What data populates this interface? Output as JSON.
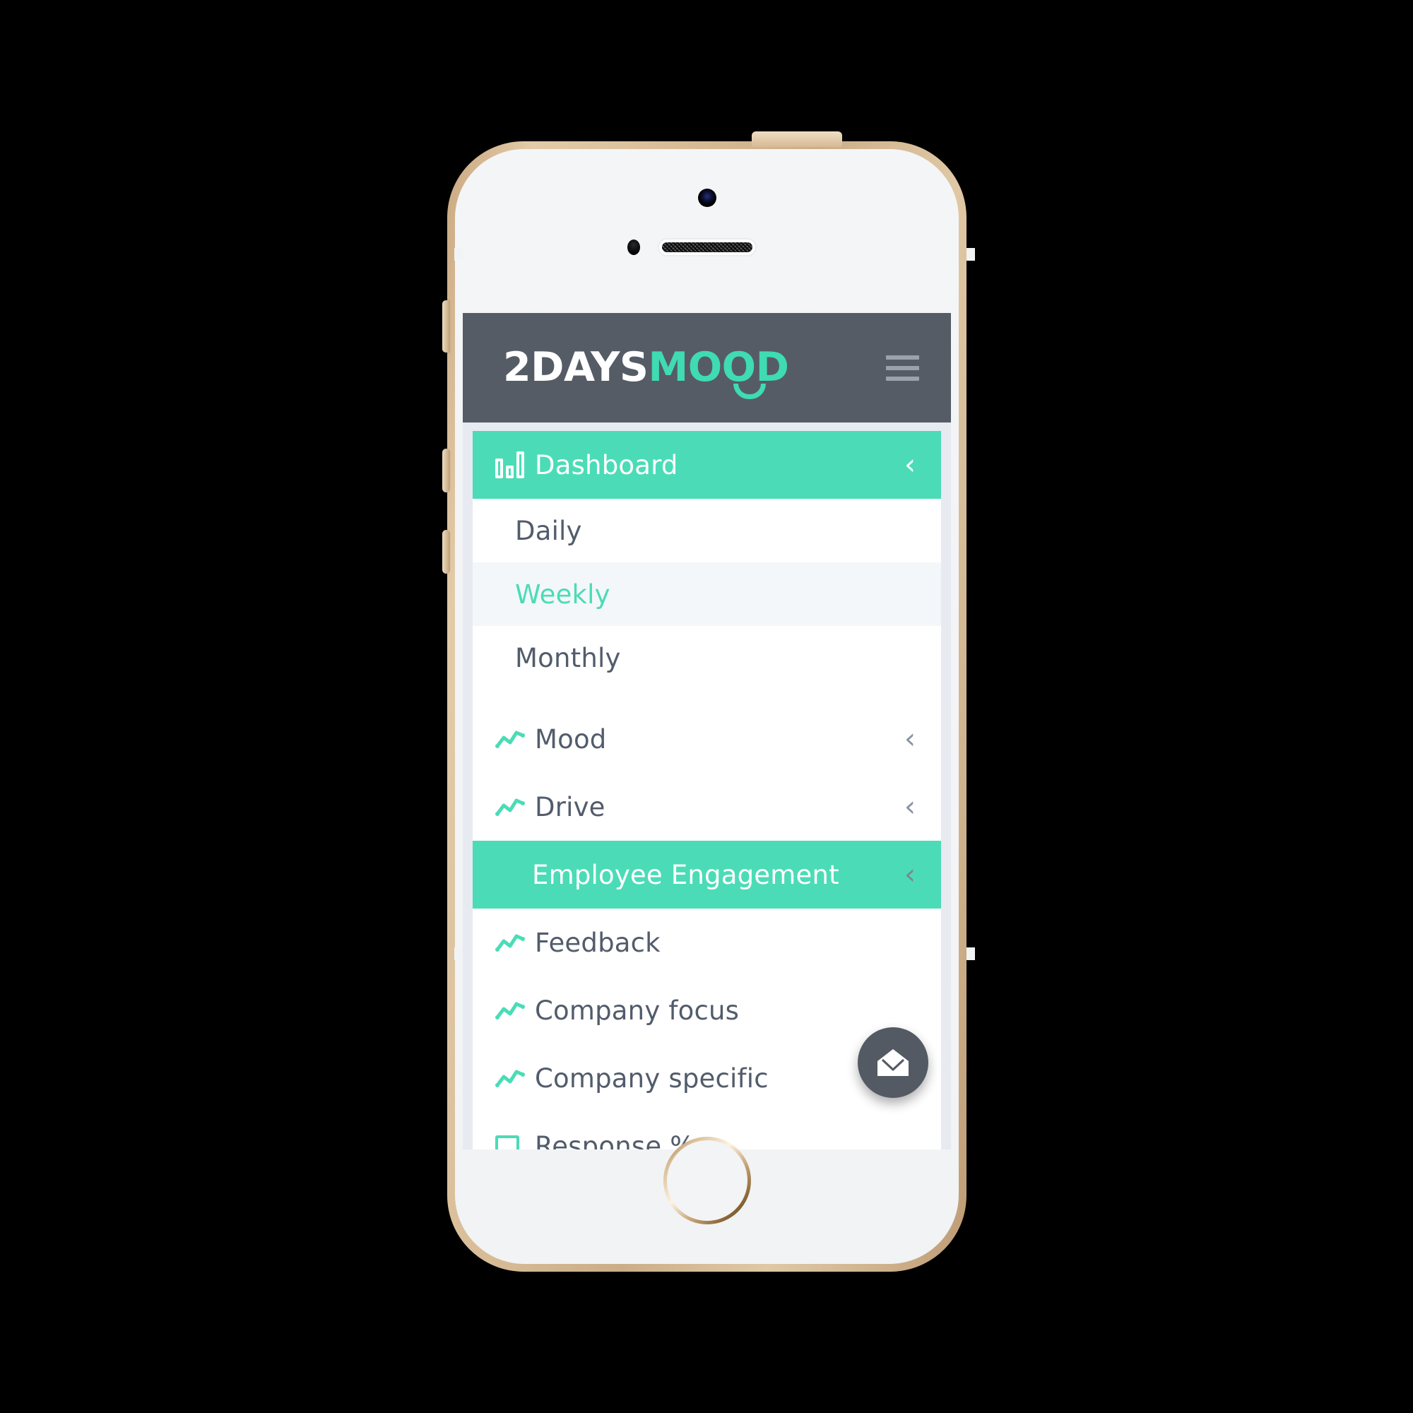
{
  "device": {
    "name": "iphone-gold",
    "bezel_color": "#D5BB95",
    "face_color": "#F3F4F6"
  },
  "screen": {
    "background": "#E7EAF0",
    "card_background": "#FFFFFF"
  },
  "appbar": {
    "background": "#565C66",
    "logo": {
      "part_one": "2DAYS",
      "part_two": "MOOD",
      "part_one_color": "#FFFFFF",
      "part_two_color": "#3FDBB1",
      "smile_icon": "smile-arc-icon"
    },
    "menu_button": {
      "icon": "hamburger-icon",
      "line_color": "#9AA2AE"
    }
  },
  "accent": {
    "teal": "#4BDCB7",
    "text_dark": "#525C6B",
    "highlight_row": "#F4F7FA"
  },
  "sidebar": {
    "items": [
      {
        "label": "Dashboard",
        "icon": "bar-chart-icon",
        "chevron": "‹",
        "state": "active",
        "level": 0
      },
      {
        "label": "Daily",
        "icon": "none",
        "chevron": "",
        "state": "default",
        "level": 1
      },
      {
        "label": "Weekly",
        "icon": "none",
        "chevron": "",
        "state": "selected",
        "level": 1
      },
      {
        "label": "Monthly",
        "icon": "none",
        "chevron": "",
        "state": "default",
        "level": 1
      },
      {
        "label": "Mood",
        "icon": "line-chart-icon",
        "chevron": "‹",
        "state": "default",
        "level": 0
      },
      {
        "label": "Drive",
        "icon": "line-chart-icon",
        "chevron": "‹",
        "state": "default",
        "level": 0
      },
      {
        "label": "Employee Engagement",
        "icon": "none",
        "chevron": "‹",
        "state": "active-sub",
        "level": 1
      },
      {
        "label": "Feedback",
        "icon": "line-chart-icon",
        "chevron": "",
        "state": "default",
        "level": 0
      },
      {
        "label": "Company focus",
        "icon": "line-chart-icon",
        "chevron": "",
        "state": "default",
        "level": 0
      },
      {
        "label": "Company specific",
        "icon": "line-chart-icon",
        "chevron": "",
        "state": "default",
        "level": 0
      },
      {
        "label": "Response %",
        "icon": "square-outline-icon",
        "chevron": "",
        "state": "default",
        "level": 0
      }
    ]
  },
  "fab": {
    "icon": "open-envelope-icon",
    "background": "#545A64",
    "icon_color": "#FFFFFF"
  }
}
